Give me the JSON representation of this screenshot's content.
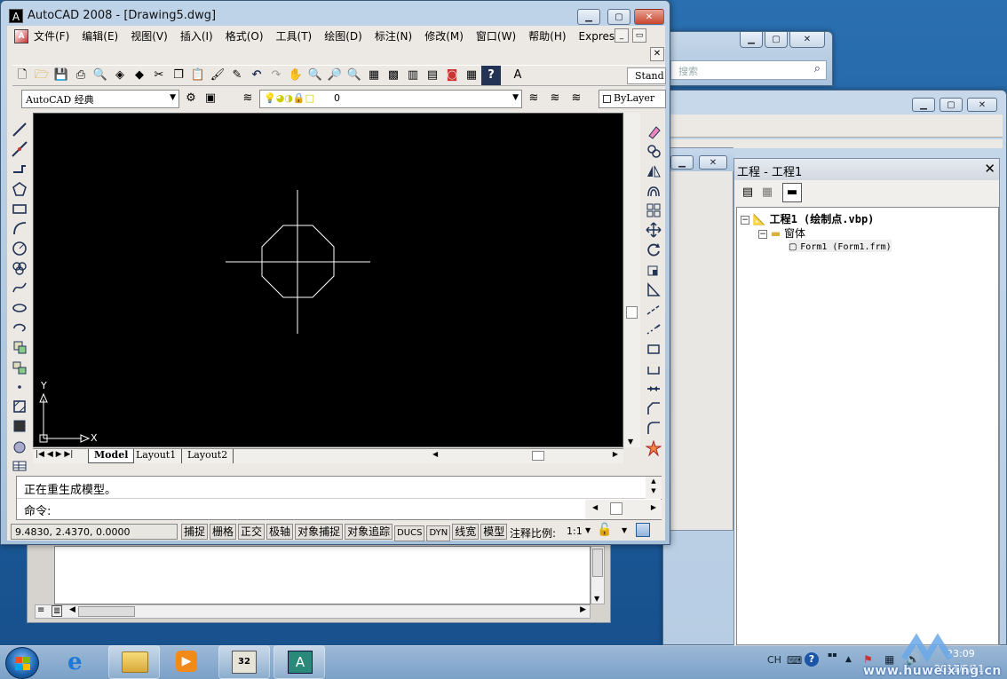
{
  "bg_window_right": {
    "search_placeholder": "搜索"
  },
  "vb_project": {
    "title": "工程 - 工程1",
    "tree_root": "工程1 (绘制点.vbp)",
    "tree_folder": "窗体",
    "tree_form": "Form1 (Form1.frm)"
  },
  "autocad": {
    "title": "AutoCAD 2008 - [Drawing5.dwg]",
    "menu": [
      "文件(F)",
      "编辑(E)",
      "视图(V)",
      "插入(I)",
      "格式(O)",
      "工具(T)",
      "绘图(D)",
      "标注(N)",
      "修改(M)",
      "窗口(W)",
      "帮助(H)",
      "Express"
    ],
    "workspace": "AutoCAD 经典",
    "layer_value": "0",
    "text_style": "Stand",
    "bylayer": "ByLayer",
    "tabs": [
      "Model",
      "Layout1",
      "Layout2"
    ],
    "ucs_x": "X",
    "ucs_y": "Y",
    "cmd_line1": "正在重生成模型。",
    "cmd_prompt": "命令:",
    "coords": "9.4830, 2.4370, 0.0000",
    "status_buttons": [
      "捕捉",
      "栅格",
      "正交",
      "极轴",
      "对象捕捉",
      "对象追踪",
      "DUCS",
      "DYN",
      "线宽",
      "模型"
    ],
    "anno_scale_label": "注释比例:",
    "anno_scale_value": "1:1"
  },
  "taskbar": {
    "lang": "CH",
    "time": "23:09",
    "date": "2011/5/11",
    "watermark": "www.huweixing.cn"
  },
  "colors": {
    "accent": "#1d5d9e",
    "canvas": "#000000",
    "drawing": "#ffffff"
  }
}
